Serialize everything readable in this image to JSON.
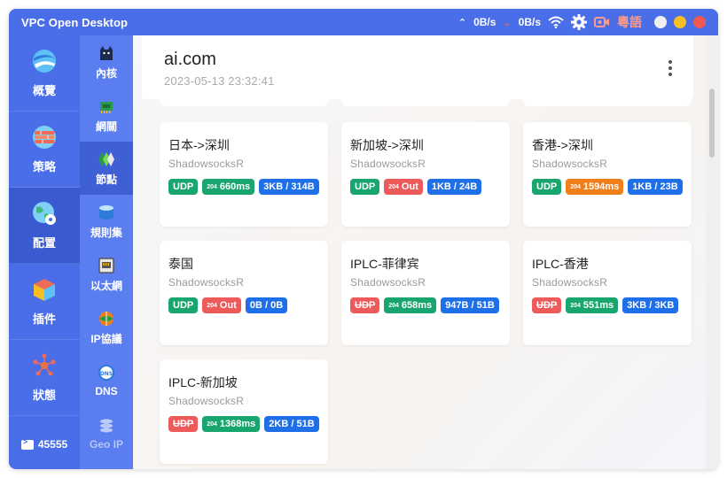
{
  "titlebar": {
    "title": "VPC Open Desktop",
    "upload_speed": "0B/s",
    "download_speed": "0B/s",
    "language_label": "粵語"
  },
  "sidebar": {
    "items": [
      {
        "label": "概覽",
        "icon": "globe-icon"
      },
      {
        "label": "策略",
        "icon": "firewall-icon"
      },
      {
        "label": "配置",
        "icon": "globe-gear-icon",
        "active": true
      },
      {
        "label": "插件",
        "icon": "cube-icon"
      },
      {
        "label": "狀態",
        "icon": "network-status-icon"
      }
    ],
    "footer_count": "45555"
  },
  "subnav": {
    "items": [
      {
        "label": "內核",
        "icon": "cat-icon"
      },
      {
        "label": "網關",
        "icon": "chip-icon"
      },
      {
        "label": "節點",
        "icon": "node-icon",
        "active": true
      },
      {
        "label": "規則集",
        "icon": "database-icon"
      },
      {
        "label": "以太網",
        "icon": "ethernet-icon"
      },
      {
        "label": "IP協議",
        "icon": "ip-globe-icon"
      },
      {
        "label": "DNS",
        "icon": "dns-icon"
      },
      {
        "label": "Geo IP",
        "icon": "stack-icon",
        "dim": true
      }
    ]
  },
  "header": {
    "hostname": "ai.com",
    "timestamp": "2023-05-13 23:32:41"
  },
  "nodes": [
    {
      "name": "日本->深圳",
      "protocol": "ShadowsocksR",
      "udp": "UDP",
      "udp_ok": true,
      "latency_code": "204",
      "latency": "660ms",
      "latency_status": "ok",
      "traffic": "3KB / 314B"
    },
    {
      "name": "新加坡->深圳",
      "protocol": "ShadowsocksR",
      "udp": "UDP",
      "udp_ok": true,
      "latency_code": "204",
      "latency": "Out",
      "latency_status": "out",
      "traffic": "1KB / 24B"
    },
    {
      "name": "香港->深圳",
      "protocol": "ShadowsocksR",
      "udp": "UDP",
      "udp_ok": true,
      "latency_code": "204",
      "latency": "1594ms",
      "latency_status": "slow",
      "traffic": "1KB / 23B"
    },
    {
      "name": "泰国",
      "protocol": "ShadowsocksR",
      "udp": "UDP",
      "udp_ok": true,
      "latency_code": "204",
      "latency": "Out",
      "latency_status": "out",
      "traffic": "0B / 0B"
    },
    {
      "name": "IPLC-菲律宾",
      "protocol": "ShadowsocksR",
      "udp": "UDP",
      "udp_ok": false,
      "latency_code": "204",
      "latency": "658ms",
      "latency_status": "ok",
      "traffic": "947B / 51B"
    },
    {
      "name": "IPLC-香港",
      "protocol": "ShadowsocksR",
      "udp": "UDP",
      "udp_ok": false,
      "latency_code": "204",
      "latency": "551ms",
      "latency_status": "ok",
      "traffic": "3KB / 3KB"
    },
    {
      "name": "IPLC-新加坡",
      "protocol": "ShadowsocksR",
      "udp": "UDP",
      "udp_ok": false,
      "latency_code": "204",
      "latency": "1368ms",
      "latency_status": "ok",
      "traffic": "2KB / 51B"
    }
  ],
  "colors": {
    "brand": "#4a6ee8",
    "ok": "#19a56e",
    "error": "#ec5a5a",
    "info": "#1e6fe8",
    "warning": "#f07f1a"
  }
}
